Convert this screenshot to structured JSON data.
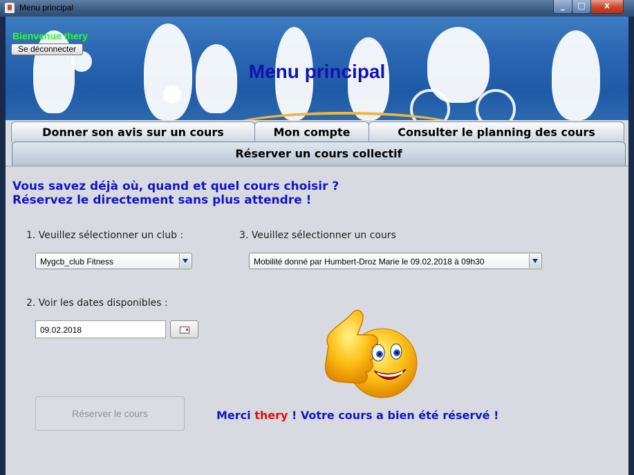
{
  "window": {
    "title": "Menu principal",
    "controls": {
      "minimize_glyph": "_",
      "maximize_glyph": "□",
      "close_glyph": "x"
    }
  },
  "banner": {
    "welcome": "Bienvenue thery",
    "logout_label": "Se déconnecter",
    "title": "Menu principal"
  },
  "tabs": {
    "avis": "Donner son avis sur un cours",
    "compte": "Mon compte",
    "planning": "Consulter le planning des cours",
    "reserver": "Réserver un cours collectif",
    "active": "reserver"
  },
  "content": {
    "headline_line1": "Vous savez déjà où, quand et quel cours choisir ?",
    "headline_line2": "Réservez le directement sans plus attendre !",
    "club_label": "1. Veuillez sélectionner un club :",
    "club_value": "Mygcb_club Fitness",
    "cours_label": "3. Veuillez sélectionner un cours",
    "cours_value": "Mobilité donné par Humbert-Droz Marie le 09.02.2018 à 09h30",
    "dates_label": "2. Voir les dates disponibles :",
    "date_value": "09.02.2018",
    "reserve_button": "Réserver le cours",
    "reserve_button_enabled": false,
    "confirm_before": "Merci ",
    "confirm_name": "thery",
    "confirm_after": " ! Votre cours a bien été réservé !"
  },
  "colors": {
    "headline": "#1414c8",
    "welcome": "#2bff2b",
    "confirm_name": "#e01010"
  },
  "icons": [
    "app-icon",
    "dropdown-arrow-icon",
    "calendar-icon",
    "thumbs-up-smiley-icon"
  ]
}
